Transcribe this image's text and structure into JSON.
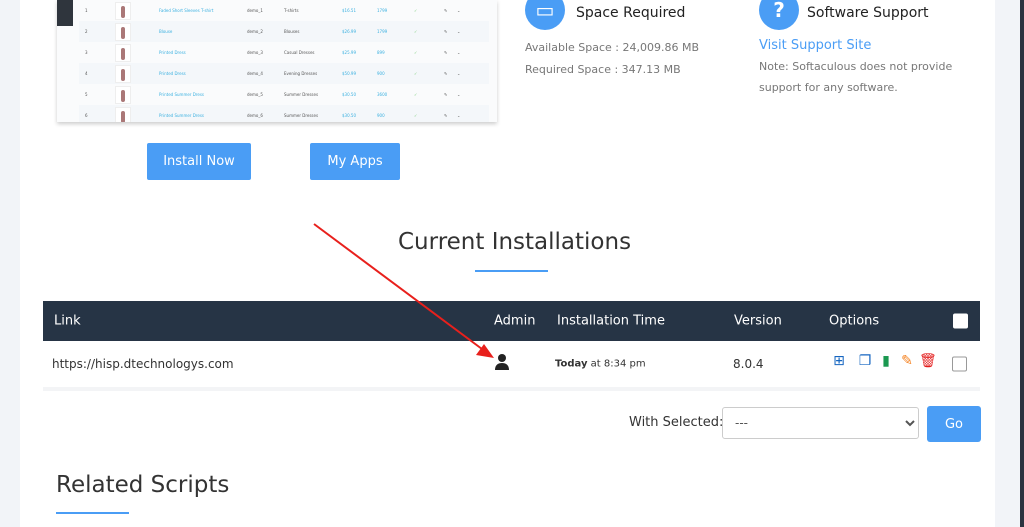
{
  "preview": {
    "rows": [
      {
        "n": "1",
        "name": "Faded Short Sleeves T-shirt",
        "ref": "demo_1",
        "cat": "T-shirts",
        "price": "$16.51",
        "qty": "1799"
      },
      {
        "n": "2",
        "name": "Blouse",
        "ref": "demo_2",
        "cat": "Blouses",
        "price": "$26.99",
        "qty": "1799"
      },
      {
        "n": "3",
        "name": "Printed Dress",
        "ref": "demo_3",
        "cat": "Casual Dresses",
        "price": "$25.99",
        "qty": "899"
      },
      {
        "n": "4",
        "name": "Printed Dress",
        "ref": "demo_4",
        "cat": "Evening Dresses",
        "price": "$50.99",
        "qty": "900"
      },
      {
        "n": "5",
        "name": "Printed Summer Dress",
        "ref": "demo_5",
        "cat": "Summer Dresses",
        "price": "$30.50",
        "qty": "3600"
      },
      {
        "n": "6",
        "name": "Printed Summer Dress",
        "ref": "demo_6",
        "cat": "Summer Dresses",
        "price": "$30.50",
        "qty": "900"
      }
    ]
  },
  "buttons": {
    "install": "Install Now",
    "myapps": "My Apps",
    "go": "Go"
  },
  "space": {
    "title": "Space Required",
    "available": "Available Space : 24,009.86 MB",
    "required": "Required Space : 347.13 MB"
  },
  "support": {
    "title": "Software Support",
    "link": "Visit Support Site",
    "note1": "Note: Softaculous does not provide",
    "note2": "support for any software."
  },
  "installations": {
    "title": "Current Installations",
    "headers": {
      "link": "Link",
      "admin": "Admin",
      "time": "Installation Time",
      "version": "Version",
      "options": "Options"
    },
    "rows": [
      {
        "link": "https://hisp.dtechnologys.com",
        "time_bold": "Today",
        "time_rest": " at 8:34 pm",
        "version": "8.0.4"
      }
    ]
  },
  "with_selected": {
    "label": "With Selected:",
    "value": "---"
  },
  "related": {
    "title": "Related Scripts"
  },
  "colors": {
    "accent": "#4a9df5",
    "header": "#263445",
    "arrow": "#e8201c"
  }
}
